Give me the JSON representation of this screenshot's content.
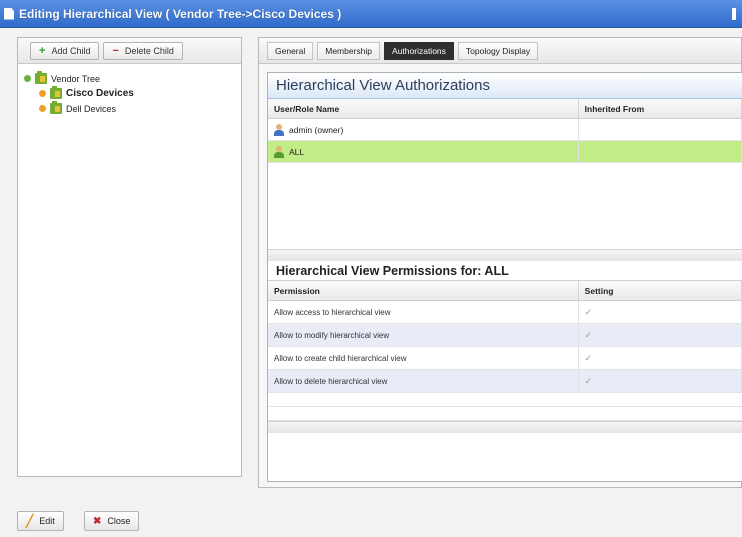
{
  "window": {
    "title": "Editing Hierarchical View ( Vendor Tree->Cisco Devices )"
  },
  "toolbar": {
    "add_child": "Add Child",
    "delete_child": "Delete Child"
  },
  "tree": {
    "root": "Vendor Tree",
    "children": [
      "Cisco Devices",
      "Dell Devices"
    ]
  },
  "tabs": [
    "General",
    "Membership",
    "Authorizations",
    "Topology Display"
  ],
  "active_tab": "Authorizations",
  "authorizations": {
    "title": "Hierarchical View Authorizations",
    "columns": [
      "User/Role Name",
      "Inherited From"
    ],
    "rows": [
      {
        "name": "admin (owner)",
        "inherited": ""
      },
      {
        "name": "ALL",
        "inherited": ""
      }
    ]
  },
  "permissions": {
    "title": "Hierarchical View Permissions for: ALL",
    "columns": [
      "Permission",
      "Setting"
    ],
    "rows": [
      {
        "permission": "Allow access to hierarchical view",
        "setting": "✓"
      },
      {
        "permission": "Allow to modify hierarchical view",
        "setting": "✓"
      },
      {
        "permission": "Allow to create child hierarchical view",
        "setting": "✓"
      },
      {
        "permission": "Allow to delete hierarchical view",
        "setting": "✓"
      }
    ]
  },
  "footer": {
    "edit": "Edit",
    "close": "Close"
  },
  "colors": {
    "title_bar": "#3f7cd8",
    "selected_row": "#c1ec88",
    "alt_row": "#e9ebf7"
  }
}
